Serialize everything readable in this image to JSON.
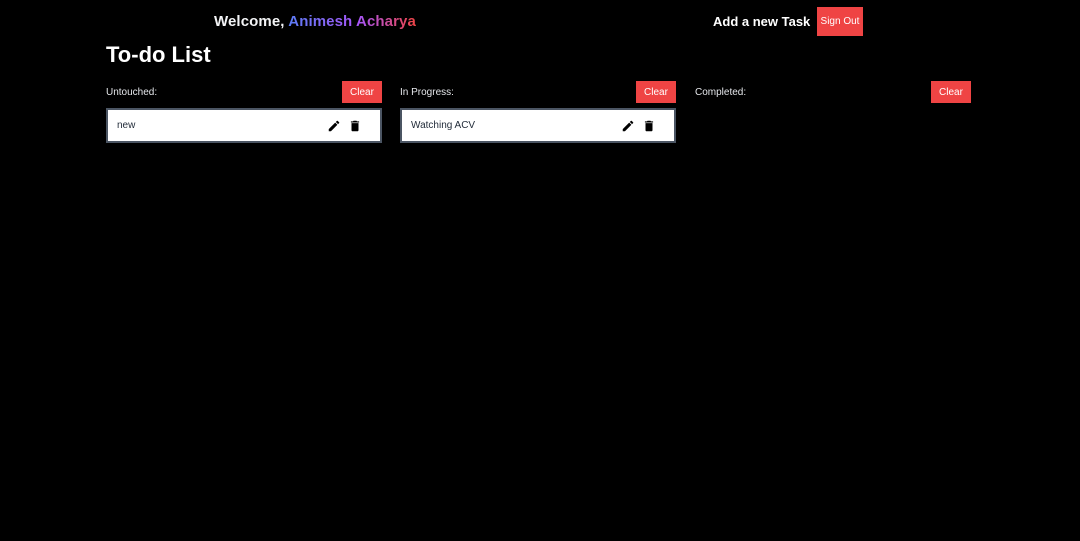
{
  "header": {
    "welcome_prefix": "Welcome, ",
    "user_name": "Animesh Acharya",
    "add_task_label": "Add a new Task",
    "sign_out_label": "Sign Out"
  },
  "page": {
    "title": "To-do List"
  },
  "columns": [
    {
      "label": "Untouched:",
      "clear_label": "Clear",
      "tasks": [
        {
          "text": "new",
          "edit_icon": "pencil-icon",
          "delete_icon": "trash-icon"
        }
      ]
    },
    {
      "label": "In Progress:",
      "clear_label": "Clear",
      "tasks": [
        {
          "text": "Watching ACV",
          "edit_icon": "pencil-icon",
          "delete_icon": "trash-icon"
        }
      ]
    },
    {
      "label": "Completed:",
      "clear_label": "Clear",
      "tasks": []
    }
  ],
  "colors": {
    "background": "#000000",
    "accent_red": "#ef4444",
    "name_gradient": [
      "#5b7cf6",
      "#a855f7",
      "#ef4444"
    ],
    "card_border": "#4b5563"
  }
}
